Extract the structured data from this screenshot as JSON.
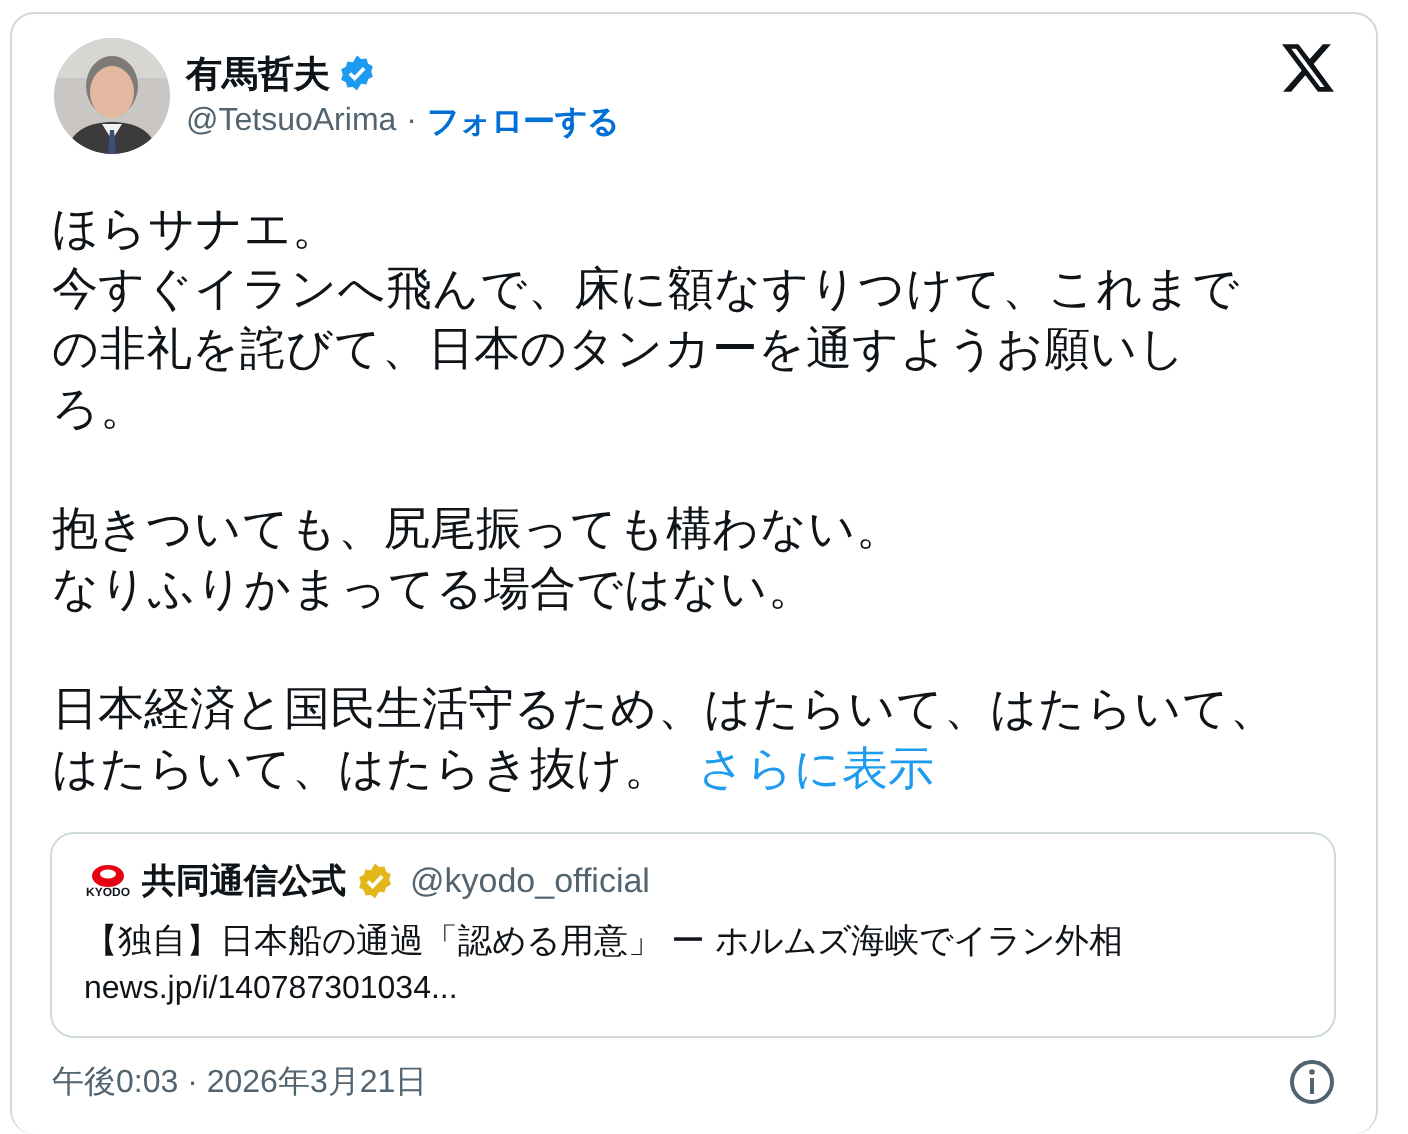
{
  "author": {
    "name": "有馬哲夫",
    "verified": true,
    "handle": "@TetsuoArima",
    "separator": "·",
    "follow": "フォローする"
  },
  "body": {
    "paragraphs": [
      [
        "ほらサナエ。",
        "今すぐイランへ飛んで、床に額なすりつけて、これまで",
        "の非礼を詫びて、日本のタンカーを通すようお願いし",
        "ろ。"
      ],
      [
        "抱きついても、尻尾振っても構わない。",
        "なりふりかまってる場合ではない。"
      ],
      [
        "日本経済と国民生活守るため、はたらいて、はたらいて、",
        "はたらいて、はたらき抜け。"
      ]
    ],
    "show_more": "さらに表示"
  },
  "quote": {
    "logo_text": "KYODO",
    "name": "共同通信公式",
    "verified": true,
    "handle": "@kyodo_official",
    "text": "【独自】日本船の通過「認める用意」 ー ホルムズ海峡でイラン外相",
    "link": "news.jp/i/140787301034..."
  },
  "footer": {
    "time": "午後0:03 · 2026年3月21日"
  }
}
